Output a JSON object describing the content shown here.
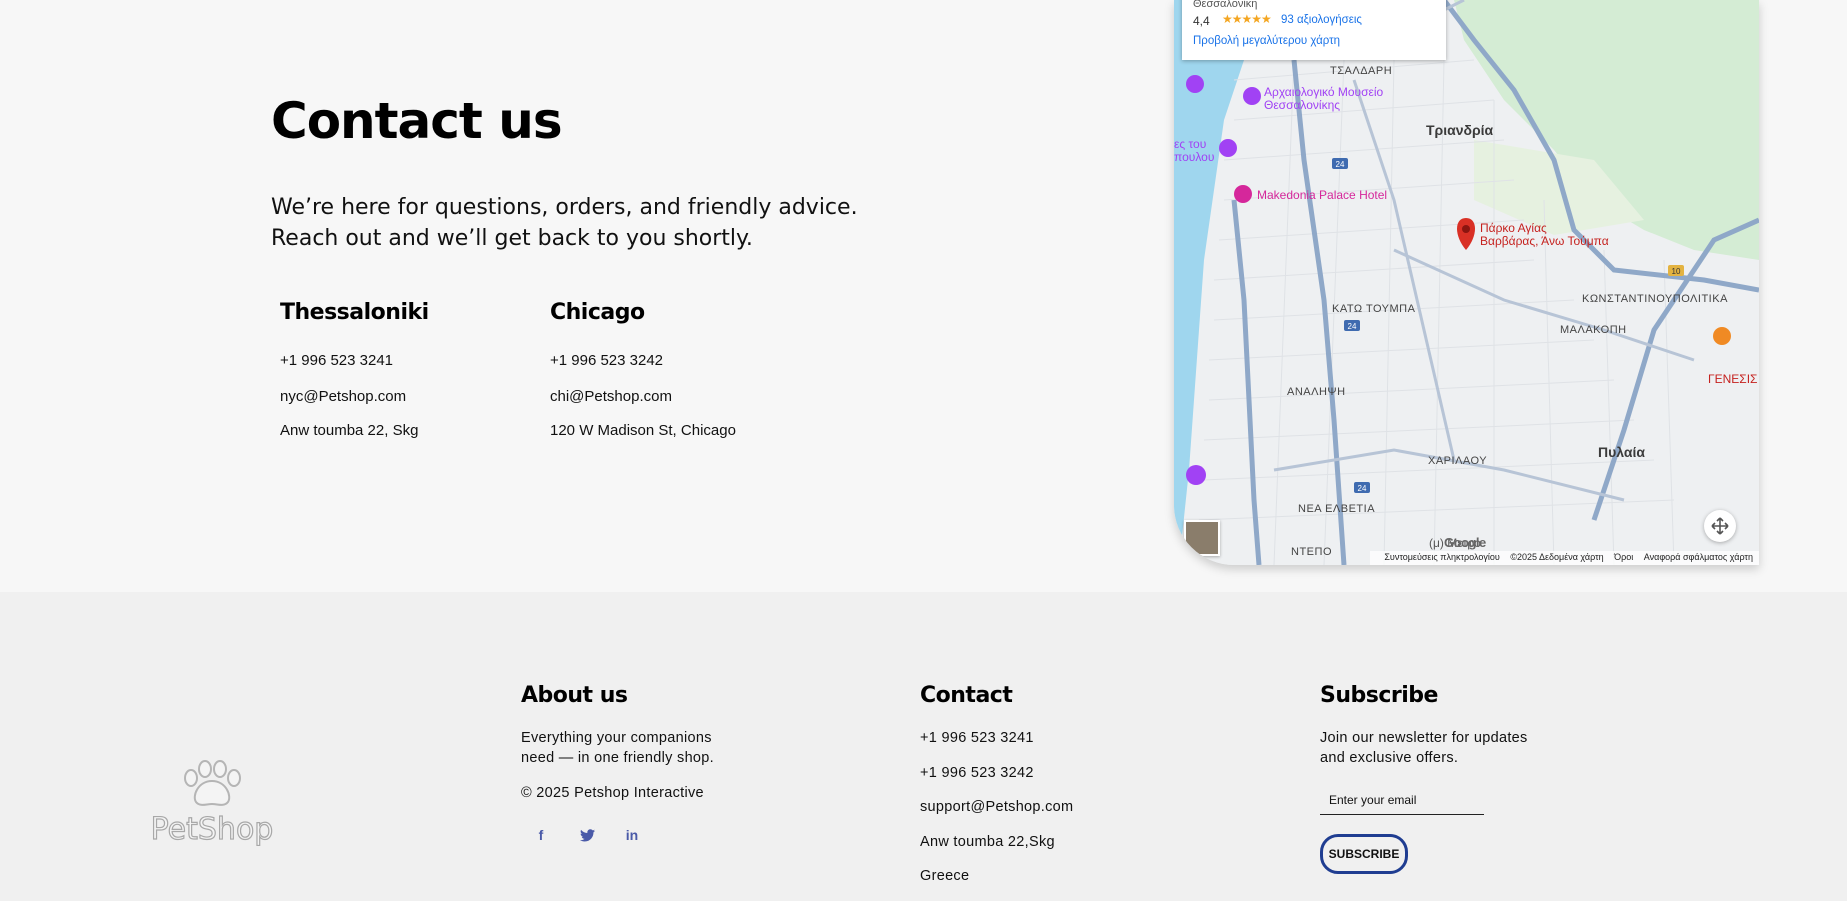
{
  "contact": {
    "title": "Contact us",
    "intro_line1": "We’re here for questions, orders, and friendly advice.",
    "intro_line2": "Reach out and we’ll get back to you shortly.",
    "offices": [
      {
        "city": "Thessaloniki",
        "phone": "+1 996 523 3241",
        "email": "nyc@Petshop.com",
        "address": "Anw toumba 22, Skg"
      },
      {
        "city": "Chicago",
        "phone": "+1 996 523 3242",
        "email": "chi@Petshop.com",
        "address": "120 W Madison St, Chicago"
      }
    ]
  },
  "map": {
    "card": {
      "address": "Θεσσαλονίκη",
      "rating": "4,4",
      "stars": "★★★★★",
      "reviews": "93 αξιολογήσεις",
      "larger_map": "Προβολή μεγαλύτερου χάρτη"
    },
    "labels": {
      "tsaldari": "ΤΣΑΛΔΑΡΗ",
      "museum_line1": "Αρχαιολογικό Μουσείο",
      "museum_line2": "Θεσσαλονίκης",
      "triandria": "Τριανδρία",
      "hotel": "Makedonia Palace Hotel",
      "place_line1": "Πάρκο Αγίας",
      "place_line2": "Βαρβάρας, Άνω Τούμπα",
      "kato_toumpa": "ΚΑΤΩ ΤΟΥΜΠΑ",
      "konstantinoupolitika": "ΚΩΝΣΤΑΝΤΙΝΟΥΠΟΛΙΤΙΚΑ",
      "malakopi": "ΜΑΛΑΚΟΠΗ",
      "analipsi": "ΑΝΑΛΗΨΗ",
      "charilaou": "ΧΑΡΙΛΑΟΥ",
      "pylaia": "Πυλαία",
      "nea_elvetia": "ΝΕΑ ΕΛΒΕΤΙΑ",
      "ntepo": "ΝΤΕΠΟ",
      "genesis": "ΓΕΝΕΣΙΣ",
      "left_edge_line1": "ες του",
      "left_edge_line2": "πουλου",
      "route_24a": "24",
      "route_24b": "24",
      "route_24c": "24",
      "route_10": "10",
      "metro": "(μ) Μετρό"
    },
    "google": "Google",
    "footer_links": [
      "Συντομεύσεις πληκτρολογίου",
      "©2025 Δεδομένα χάρτη",
      "Όροι",
      "Αναφορά σφάλματος χάρτη"
    ]
  },
  "footer": {
    "logo_text": "PetShop",
    "about": {
      "heading": "About us",
      "line1": "Everything your companions",
      "line2": "need — in one friendly shop.",
      "copyright": "© 2025 Petshop Interactive"
    },
    "social": {
      "facebook": "f",
      "twitter": "t",
      "linkedin": "in"
    },
    "contact": {
      "heading": "Contact",
      "phone1": "+1 996 523 3241",
      "phone2": "+1 996 523 3242",
      "email": "support@Petshop.com",
      "address": "Anw toumba 22,Skg",
      "country": "Greece"
    },
    "subscribe": {
      "heading": "Subscribe",
      "line1": "Join our newsletter for updates",
      "line2": "and exclusive offers.",
      "placeholder": "Enter your email",
      "button": "SUBSCRIBE"
    }
  }
}
